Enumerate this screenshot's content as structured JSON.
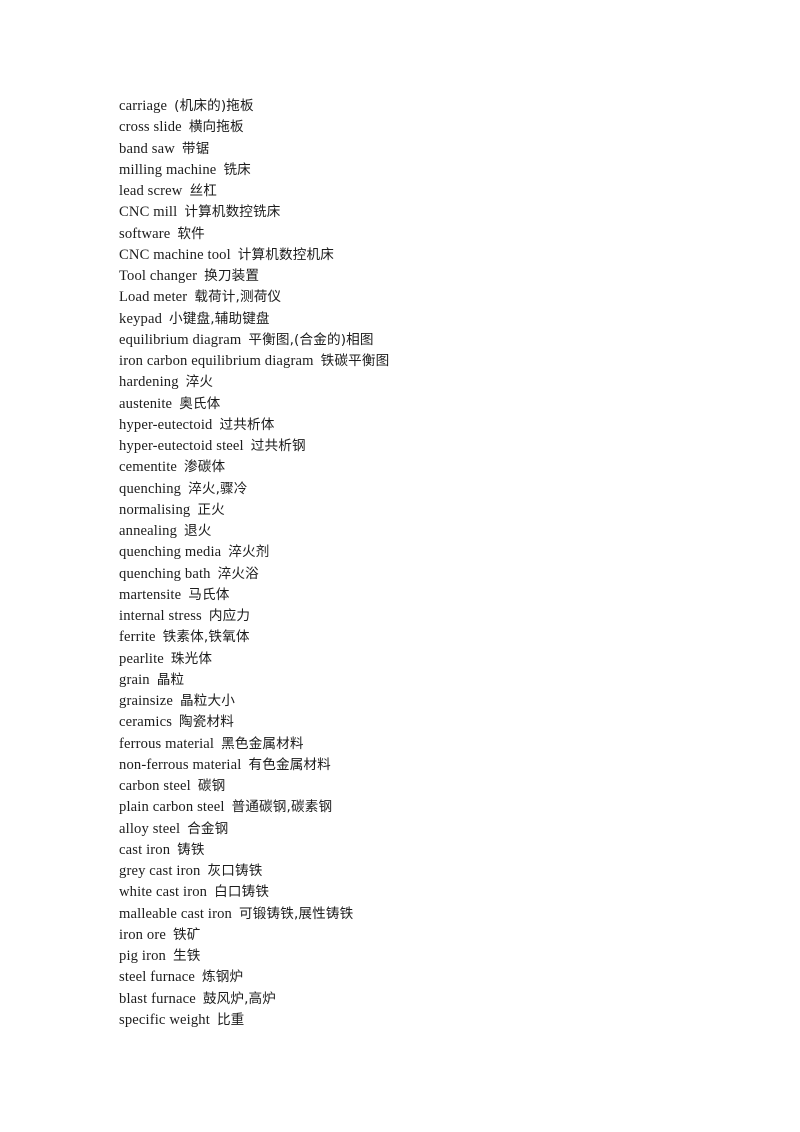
{
  "document": {
    "type": "glossary",
    "language_pair": "English-Chinese",
    "subject": "machining and metallurgy terminology",
    "entries": [
      {
        "term": "carriage",
        "gloss": "(机床的)拖板"
      },
      {
        "term": "cross slide",
        "gloss": "横向拖板"
      },
      {
        "term": "band saw",
        "gloss": "带锯"
      },
      {
        "term": "milling machine",
        "gloss": "铣床"
      },
      {
        "term": "lead screw",
        "gloss": "丝杠"
      },
      {
        "term": "CNC mill",
        "gloss": "计算机数控铣床"
      },
      {
        "term": "software",
        "gloss": "软件"
      },
      {
        "term": "CNC machine tool",
        "gloss": "计算机数控机床"
      },
      {
        "term": "Tool changer",
        "gloss": "换刀装置"
      },
      {
        "term": "Load meter",
        "gloss": "载荷计,测荷仪"
      },
      {
        "term": "keypad",
        "gloss": "小键盘,辅助键盘"
      },
      {
        "term": "equilibrium diagram",
        "gloss": "平衡图,(合金的)相图"
      },
      {
        "term": "iron carbon equilibrium diagram",
        "gloss": "铁碳平衡图"
      },
      {
        "term": "hardening",
        "gloss": "淬火"
      },
      {
        "term": "austenite",
        "gloss": "奥氏体"
      },
      {
        "term": "hyper-eutectoid",
        "gloss": "过共析体"
      },
      {
        "term": "hyper-eutectoid steel",
        "gloss": "过共析钢"
      },
      {
        "term": "cementite",
        "gloss": "渗碳体"
      },
      {
        "term": "quenching",
        "gloss": "淬火,骤冷"
      },
      {
        "term": "normalising",
        "gloss": "正火"
      },
      {
        "term": "annealing",
        "gloss": "退火"
      },
      {
        "term": "quenching media",
        "gloss": "淬火剂"
      },
      {
        "term": "quenching bath",
        "gloss": "淬火浴"
      },
      {
        "term": "martensite",
        "gloss": "马氏体"
      },
      {
        "term": "internal stress",
        "gloss": "内应力"
      },
      {
        "term": "ferrite",
        "gloss": "铁素体,铁氧体"
      },
      {
        "term": "pearlite",
        "gloss": "珠光体"
      },
      {
        "term": "grain",
        "gloss": "晶粒"
      },
      {
        "term": "grainsize",
        "gloss": "晶粒大小"
      },
      {
        "term": "ceramics",
        "gloss": "陶瓷材料"
      },
      {
        "term": "ferrous material",
        "gloss": "黑色金属材料"
      },
      {
        "term": "non-ferrous material",
        "gloss": "有色金属材料"
      },
      {
        "term": "carbon steel",
        "gloss": "碳钢"
      },
      {
        "term": "plain carbon steel",
        "gloss": "普通碳钢,碳素钢"
      },
      {
        "term": "alloy steel",
        "gloss": "合金钢"
      },
      {
        "term": "cast iron",
        "gloss": "铸铁"
      },
      {
        "term": "grey cast iron",
        "gloss": "灰口铸铁"
      },
      {
        "term": "white cast iron",
        "gloss": "白口铸铁"
      },
      {
        "term": "malleable cast iron",
        "gloss": "可锻铸铁,展性铸铁"
      },
      {
        "term": "iron ore",
        "gloss": "铁矿"
      },
      {
        "term": "pig iron",
        "gloss": "生铁"
      },
      {
        "term": "steel furnace",
        "gloss": "炼钢炉"
      },
      {
        "term": "blast furnace",
        "gloss": "鼓风炉,高炉"
      },
      {
        "term": "specific weight",
        "gloss": "比重"
      }
    ]
  },
  "colors": {
    "page_background": "#ffffff",
    "text": "#1c1c1c"
  }
}
